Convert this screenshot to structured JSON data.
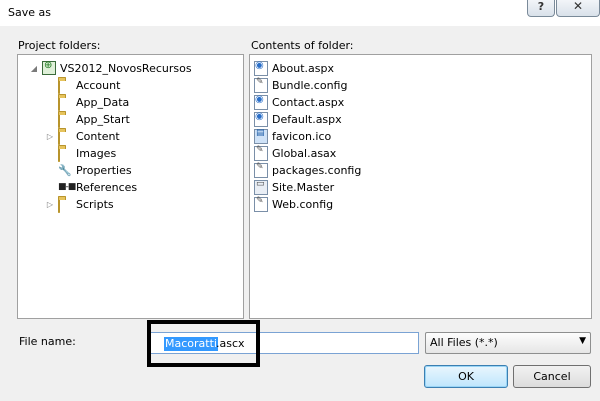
{
  "window": {
    "title": "Save as",
    "help_label": "?",
    "close_label": "✕"
  },
  "project_folders": {
    "label": "Project folders:",
    "root": {
      "label": "VS2012_NovosRecursos",
      "expander": "◢"
    },
    "items": [
      {
        "label": "Account",
        "icon": "folder-icon",
        "expander": ""
      },
      {
        "label": "App_Data",
        "icon": "folder-icon",
        "expander": ""
      },
      {
        "label": "App_Start",
        "icon": "folder-icon",
        "expander": ""
      },
      {
        "label": "Content",
        "icon": "folder-icon",
        "expander": "▷"
      },
      {
        "label": "Images",
        "icon": "folder-icon",
        "expander": ""
      },
      {
        "label": "Properties",
        "icon": "wrench-icon",
        "expander": ""
      },
      {
        "label": "References",
        "icon": "references-icon",
        "expander": ""
      },
      {
        "label": "Scripts",
        "icon": "folder-icon",
        "expander": "▷"
      }
    ]
  },
  "contents": {
    "label": "Contents of folder:",
    "files": [
      {
        "label": "About.aspx",
        "icon": "web-form-icon"
      },
      {
        "label": "Bundle.config",
        "icon": "config-file-icon"
      },
      {
        "label": "Contact.aspx",
        "icon": "web-form-icon"
      },
      {
        "label": "Default.aspx",
        "icon": "web-form-icon"
      },
      {
        "label": "favicon.ico",
        "icon": "icon-file-icon"
      },
      {
        "label": "Global.asax",
        "icon": "config-file-icon"
      },
      {
        "label": "packages.config",
        "icon": "config-file-icon"
      },
      {
        "label": "Site.Master",
        "icon": "master-page-icon"
      },
      {
        "label": "Web.config",
        "icon": "config-file-icon"
      }
    ]
  },
  "file_name": {
    "label": "File name:",
    "selected_text": "Macoratti",
    "rest_text": ".ascx"
  },
  "filter": {
    "value": "All Files (*.*)",
    "arrow": "▼"
  },
  "buttons": {
    "ok": "OK",
    "cancel": "Cancel"
  }
}
